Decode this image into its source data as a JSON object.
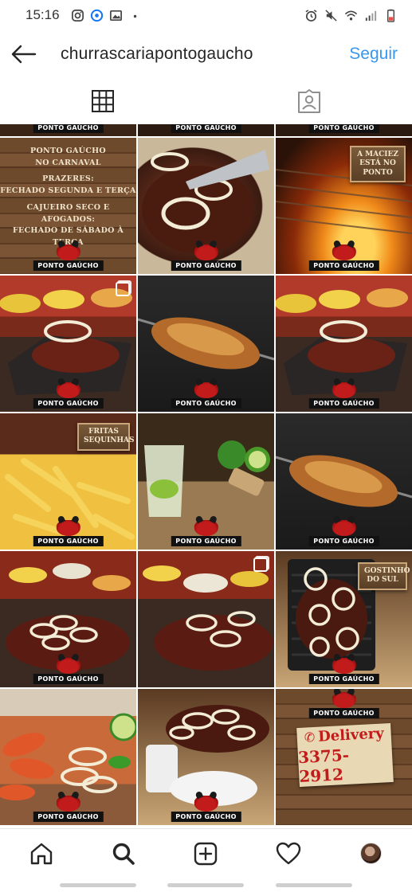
{
  "status_bar": {
    "time": "15:16",
    "left_icons": [
      "instagram-icon",
      "messenger-icon",
      "gallery-icon",
      "dot-icon"
    ],
    "right_icons": [
      "alarm-icon",
      "mute-icon",
      "wifi-icon",
      "signal-icon",
      "battery-icon"
    ]
  },
  "header": {
    "username": "churrascariapontogaucho",
    "follow_label": "Seguir"
  },
  "tabs": [
    {
      "name": "grid-view-icon",
      "active": true
    },
    {
      "name": "tagged-photos-icon",
      "active": false
    }
  ],
  "brand_label": "PONTO GAÚCHO",
  "posts": {
    "carnaval_text": [
      "PONTO GAÚCHO",
      "NO CARNAVAL",
      "",
      "PRAZERES:",
      "FECHADO SEGUNDA E TERÇA",
      "",
      "CAJUEIRO SECO E AFOGADOS:",
      "FECHADO DE SÁBADO À TERÇA"
    ],
    "maciez_sign": "A MACIEZ ESTÁ NO PONTO",
    "fritas_sign": "FRITAS SEQUINHAS",
    "gostinho_sign": "GOSTINHO DO SUL",
    "delivery_label": "Delivery",
    "delivery_phone": "3375-2912"
  },
  "bottom_nav": [
    "home-icon",
    "search-icon",
    "new-post-icon",
    "activity-heart-icon",
    "profile-avatar"
  ]
}
